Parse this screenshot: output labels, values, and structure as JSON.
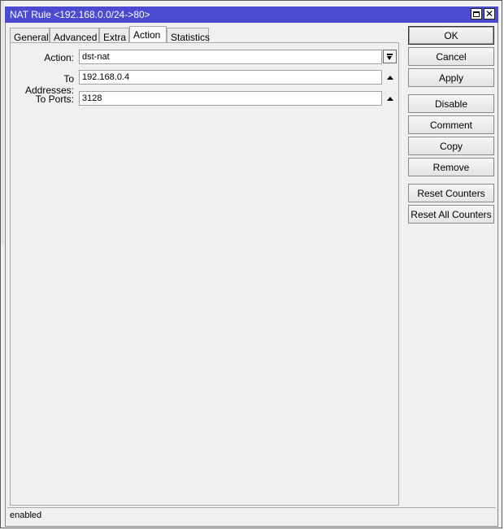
{
  "window": {
    "title": "NAT Rule <192.168.0.0/24->80>",
    "maximize_icon": "maximize-icon",
    "close_icon": "close-icon"
  },
  "tabs": [
    {
      "label": "General",
      "active": false
    },
    {
      "label": "Advanced",
      "active": false
    },
    {
      "label": "Extra",
      "active": false
    },
    {
      "label": "Action",
      "active": true
    },
    {
      "label": "Statistics",
      "active": false
    }
  ],
  "form": {
    "action": {
      "label": "Action:",
      "value": "dst-nat"
    },
    "to_addresses": {
      "label": "To Addresses:",
      "value": "192.168.0.4"
    },
    "to_ports": {
      "label": "To Ports:",
      "value": "3128"
    }
  },
  "buttons": {
    "ok": "OK",
    "cancel": "Cancel",
    "apply": "Apply",
    "disable": "Disable",
    "comment": "Comment",
    "copy": "Copy",
    "remove": "Remove",
    "reset_counters": "Reset Counters",
    "reset_all_counters": "Reset All Counters"
  },
  "status": {
    "text": "enabled"
  },
  "colors": {
    "titlebar": "#4b4bd2",
    "window_bg": "#f0f0f0"
  }
}
